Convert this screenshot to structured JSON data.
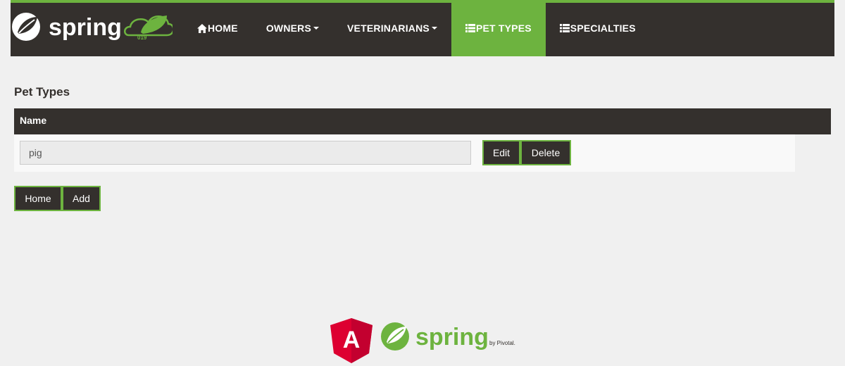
{
  "brand": {
    "logo_text": "spring",
    "badge_text": "019"
  },
  "nav": {
    "items": [
      {
        "label": "HOME",
        "icon": "home-icon"
      },
      {
        "label": "OWNERS",
        "icon": "caret-down-icon"
      },
      {
        "label": "VETERINARIANS",
        "icon": "caret-down-icon"
      },
      {
        "label": "PET TYPES",
        "icon": "list-icon"
      },
      {
        "label": "SPECIALTIES",
        "icon": "list-icon"
      }
    ],
    "active": "PET TYPES"
  },
  "page": {
    "title": "Pet Types"
  },
  "table": {
    "columns": [
      "Name"
    ],
    "rows": [
      {
        "name": "pig",
        "edit_label": "Edit",
        "delete_label": "Delete"
      }
    ]
  },
  "actions": {
    "home_label": "Home",
    "add_label": "Add"
  },
  "footer": {
    "angular_letter": "A",
    "spring_text": "spring",
    "pivotal_text": "by Pivotal."
  },
  "colors": {
    "brand_dark": "#34302d",
    "brand_green": "#6db33f",
    "page_bg": "#f0f0f0",
    "angular_red": "#dd0031"
  }
}
